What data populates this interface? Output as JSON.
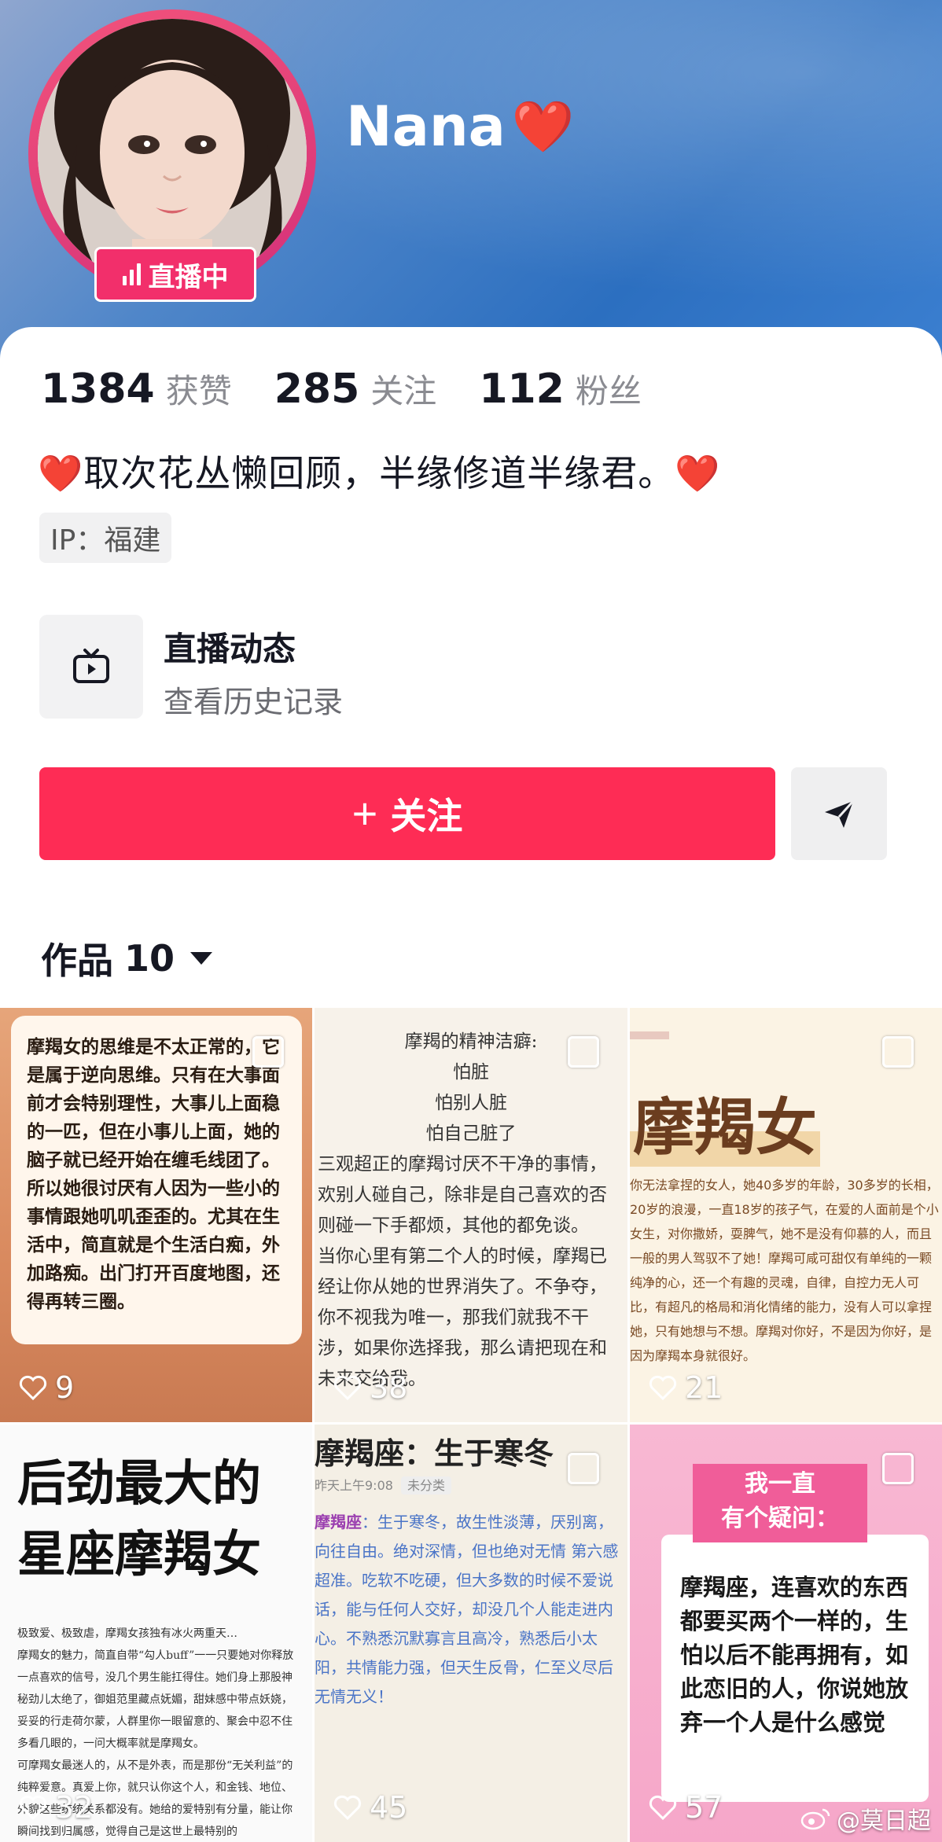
{
  "profile": {
    "username": "Nana",
    "username_emoji": "❤️",
    "live_badge": "直播中",
    "stats": [
      {
        "value": "1384",
        "label": "获赞"
      },
      {
        "value": "285",
        "label": "关注"
      },
      {
        "value": "112",
        "label": "粉丝"
      }
    ],
    "bio": "取次花丛懒回顾，半缘修道半缘君。",
    "bio_emoji": "❤️",
    "ip": "IP：福建"
  },
  "live_section": {
    "title": "直播动态",
    "subtitle": "查看历史记录"
  },
  "actions": {
    "follow_label": "关注",
    "follow_plus": "+"
  },
  "works": {
    "label": "作品",
    "count": "10"
  },
  "tiles": [
    {
      "likes": "9",
      "text": "摩羯女的思维是不太正常的，它是属于逆向思维。只有在大事面前才会特别理性，大事儿上面稳的一匹，但在小事儿上面，她的脑子就已经开始在缠毛线团了。\n所以她很讨厌有人因为一些小的事情跟她叽叽歪歪的。尤其在生活中，简直就是个生活白痴，外加路痴。出门打开百度地图，还得再转三圈。"
    },
    {
      "likes": "38",
      "lines_center": [
        "摩羯的精神洁癖:",
        "怕脏",
        "怕别人脏",
        "怕自己脏了"
      ],
      "text": "三观超正的摩羯讨厌不干净的事情，欢别人碰自己，除非是自己喜欢的否则碰一下手都烦，其他的都免谈。\n当你心里有第二个人的时候，摩羯已经让你从她的世界消失了。不争夺，你不视我为唯一，那我们就我不干涉，如果你选择我，那么请把现在和未来交给我。"
    },
    {
      "likes": "21",
      "title": "摩羯女",
      "text": "你无法拿捏的女人，她40多岁的年龄，30多岁的长相，20岁的浪漫，一直18岁的孩子气，在爱的人面前是个小女生，对你撒娇，耍脾气，她不是没有仰慕的人，而且一般的男人驾驭不了她！摩羯可咸可甜仅有单纯的一颗纯净的心，还一个有趣的灵魂，自律，自控力无人可比，有超凡的格局和消化情绪的能力，没有人可以拿捏她，只有她想与不想。摩羯对你好，不是因为你好，是因为摩羯本身就很好。"
    },
    {
      "likes": "32",
      "title_lines": [
        "后劲最大的",
        "星座摩羯女"
      ],
      "text": "极致爱、极致虐，摩羯女孩独有冰火两重天…\n摩羯女的魅力，简直自带“勾人buff”一一只要她对你释放一点喜欢的信号，没几个男生能扛得住。她们身上那股神秘劲儿太绝了，御姐范里藏点妩媚，甜妹感中带点妖娆，妥妥的行走荷尔蒙，人群里你一眼留意的、聚会中忍不住多看几眼的，一问大概率就是摩羯女。\n可摩羯女最迷人的，从不是外表，而是那份“无关利益”的纯粹爱意。真爱上你，就只认你这个人，和金钱、地位、外貌这些统统关系都没有。她给的爱特别有分量，能让你瞬间找到归属感，觉得自己是这世上最特别的"
    },
    {
      "likes": "45",
      "title": "摩羯座：生于寒冬",
      "meta": "昨天上午9:08",
      "meta_tag": "未分类",
      "key": "摩羯座",
      "text": "：生于寒冬，故生性淡薄，厌别离，向往自由。绝对深情，但也绝对无情 第六感超准。吃软不吃硬，但大多数的时候不爱说话，能与任何人交好，却没几个人能走进内心。不熟悉沉默寡言且高冷，熟悉后小太阳，共情能力强，但天生反骨，仁至义尽后无情无义！"
    },
    {
      "likes": "57",
      "banner_lines": [
        "我一直",
        "有个疑问："
      ],
      "text": "摩羯座，连喜欢的东西都要买两个一样的，生怕以后不能再拥有，如此恋旧的人，你说她放弃一个人是什么感觉"
    }
  ],
  "watermark": "@莫日超",
  "colors": {
    "accent": "#fe2c55",
    "live_badge": "#f22f6b",
    "header_blue": "#2c6fc0"
  }
}
